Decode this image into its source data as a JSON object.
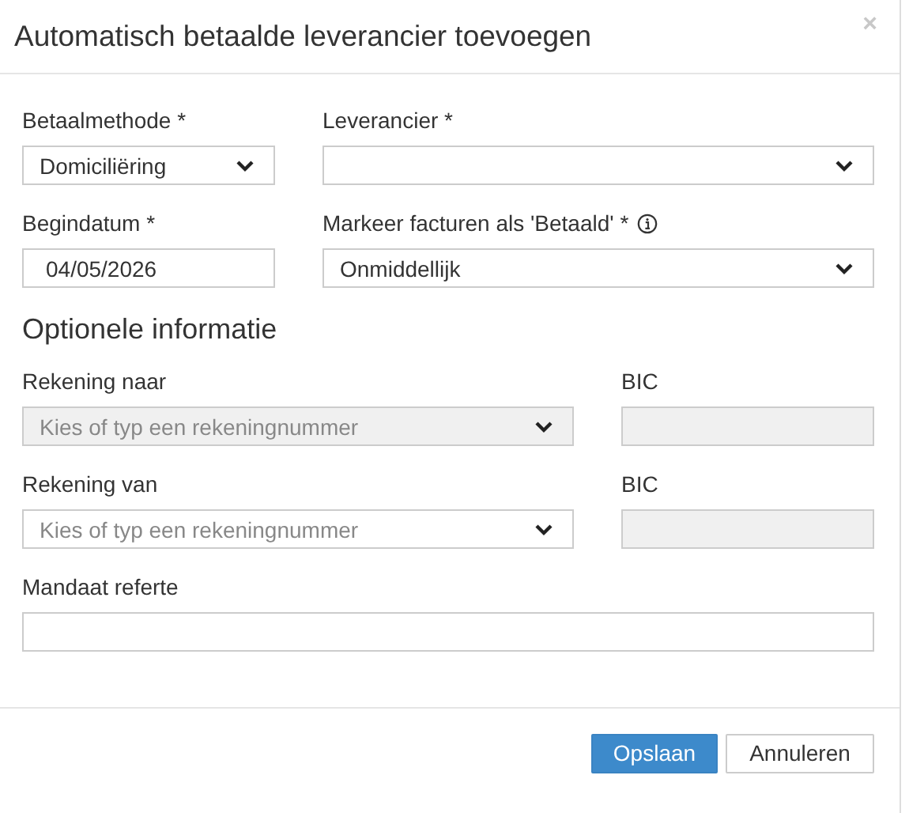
{
  "dialog": {
    "title": "Automatisch betaalde leverancier toevoegen",
    "close": "×"
  },
  "rows": [
    {
      "fields": [
        {
          "kind": "select",
          "label": "Betaalmethode *",
          "value": "Domiciliëring",
          "disabled": false
        },
        {
          "kind": "select",
          "label": "Leverancier *",
          "disabled": false
        }
      ]
    },
    {
      "fields": [
        {
          "kind": "text",
          "label": "Begindatum *",
          "value": "04/05/2026",
          "disabled": false
        },
        {
          "kind": "select",
          "label": "Markeer facturen als 'Betaald' *",
          "info": true,
          "value": "Onmiddellijk",
          "disabled": false
        }
      ]
    }
  ],
  "section_title": "Optionele informatie",
  "optional_rows": [
    {
      "fields": [
        {
          "kind": "select",
          "label": "Rekening naar",
          "placeholder": "Kies of typ een rekeningnummer",
          "disabled": true
        },
        {
          "kind": "text",
          "label": "BIC",
          "disabled": true
        }
      ]
    },
    {
      "fields": [
        {
          "kind": "select",
          "label": "Rekening van",
          "placeholder": "Kies of typ een rekeningnummer",
          "disabled": false
        },
        {
          "kind": "text",
          "label": "BIC",
          "disabled": true
        }
      ]
    },
    {
      "fields": [
        {
          "kind": "text",
          "label": "Mandaat referte",
          "disabled": false
        }
      ]
    }
  ],
  "buttons": [
    {
      "label": "Opslaan",
      "kind": "primary"
    },
    {
      "label": "Annuleren",
      "kind": "default"
    }
  ]
}
